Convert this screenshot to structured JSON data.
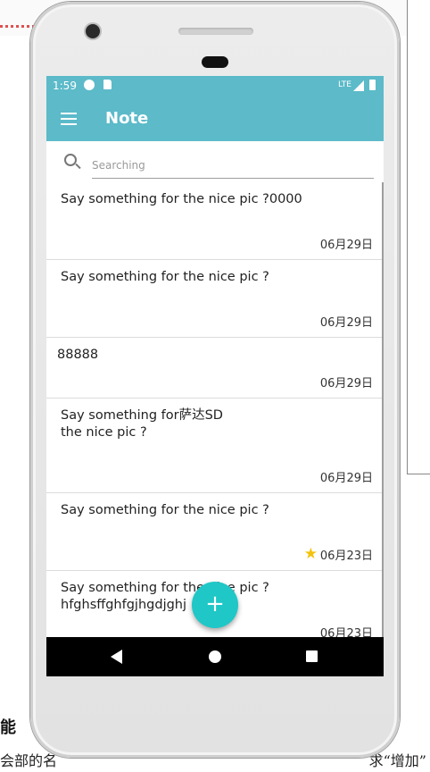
{
  "status": {
    "time": "1:59",
    "network": "LTE"
  },
  "app": {
    "title": "Note"
  },
  "search": {
    "placeholder": "Searching"
  },
  "notes": [
    {
      "text": "Say something for the nice pic ?0000",
      "date": "06月29日",
      "starred": false
    },
    {
      "text": "Say something for the nice pic ?",
      "date": "06月29日",
      "starred": false
    },
    {
      "text": "88888",
      "date": "06月29日",
      "starred": false
    },
    {
      "text": "Say something for萨达SD\nthe nice pic ?",
      "date": "06月29日",
      "starred": false
    },
    {
      "text": "Say something for the nice pic ?",
      "date": "06月23日",
      "starred": true
    },
    {
      "text": "Say something for the nice pic ?\nhfghsffghfgjhgdjghj",
      "date": "06月23日",
      "starred": false
    }
  ],
  "fab": {
    "label": "+"
  },
  "colors": {
    "primary": "#5cbac9",
    "accent": "#1fc7c7",
    "star": "#f4c20d"
  },
  "background": {
    "heading_fragment": "能",
    "text_left": "会部的名",
    "text_right": "求“增加”"
  }
}
